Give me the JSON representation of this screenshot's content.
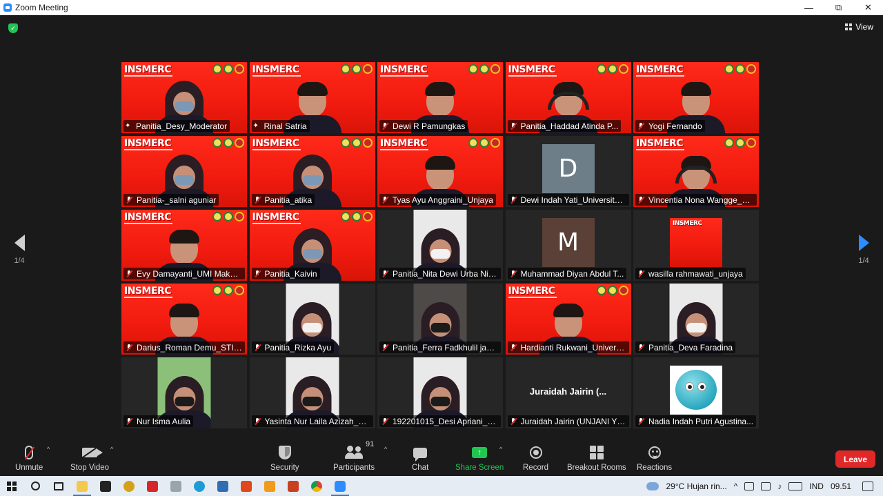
{
  "window": {
    "title": "Zoom Meeting",
    "controls": [
      "minimize",
      "restore",
      "close"
    ]
  },
  "top": {
    "view_label": "View"
  },
  "pager": {
    "left": "1/4",
    "right": "1/4"
  },
  "banner": {
    "text": "INSMERC"
  },
  "participants": [
    {
      "name": "Panitia_Desy_Moderator",
      "style": "banner",
      "active": true,
      "mic": "pinned"
    },
    {
      "name": "Rinal Satria",
      "style": "banner",
      "mic": "pinned"
    },
    {
      "name": "Dewi R Pamungkas",
      "style": "banner",
      "mic": "muted"
    },
    {
      "name": "Panitia_Haddad Atinda P...",
      "style": "banner",
      "mic": "muted"
    },
    {
      "name": "Yogi Fernando",
      "style": "banner",
      "mic": "muted"
    },
    {
      "name": "Panitia-_salni aguniar",
      "style": "banner",
      "mic": "muted"
    },
    {
      "name": "Panitia_atika",
      "style": "banner",
      "mic": "muted"
    },
    {
      "name": "Tyas Ayu Anggraini_Unjaya",
      "style": "banner",
      "mic": "muted"
    },
    {
      "name": "Dewi Indah Yati_Universitas...",
      "style": "avatar",
      "initial": "D",
      "avatar_color": "#6e7e89",
      "mic": "muted"
    },
    {
      "name": "Vincentia Nona Wangge_St...",
      "style": "banner",
      "mic": "muted"
    },
    {
      "name": "Evy Damayanti_UMI Makas...",
      "style": "banner",
      "mic": "muted"
    },
    {
      "name": "Panitia_Kaivin",
      "style": "banner",
      "mic": "muted"
    },
    {
      "name": "Panitia_Nita Dewi Urba Nid...",
      "style": "video",
      "mic": "muted"
    },
    {
      "name": "Muhammad Diyan Abdul T...",
      "style": "avatar",
      "initial": "M",
      "avatar_color": "#5a4037",
      "mic": "muted"
    },
    {
      "name": "wasilla rahmawati_unjaya",
      "style": "banner-small",
      "mic": "muted"
    },
    {
      "name": "Darius_Roman Demu_STIK...",
      "style": "banner",
      "mic": "muted"
    },
    {
      "name": "Panitia_Rizka Ayu",
      "style": "video",
      "mic": "muted"
    },
    {
      "name": "Panitia_Ferra Fadkhulil jann...",
      "style": "video-dark",
      "mic": "muted"
    },
    {
      "name": "Hardianti Rukwani_Universi...",
      "style": "banner",
      "mic": "muted"
    },
    {
      "name": "Panitia_Deva Faradina",
      "style": "video",
      "mic": "muted"
    },
    {
      "name": "Nur Isma Aulia",
      "style": "video-green",
      "mic": "muted"
    },
    {
      "name": "Yasinta Nur Laila Azizah_Un...",
      "style": "video",
      "mic": "muted"
    },
    {
      "name": "192201015_Desi Apriani_U...",
      "style": "video",
      "mic": "muted"
    },
    {
      "name": "Juraidah Jairin (UNJANI YO...",
      "style": "name-only",
      "display": "Juraidah Jairin (...",
      "mic": "muted"
    },
    {
      "name": "Nadia Indah Putri Agustina...",
      "style": "fluff",
      "mic": "muted"
    }
  ],
  "toolbar": {
    "unmute": "Unmute",
    "stop_video": "Stop Video",
    "security": "Security",
    "participants": "Participants",
    "participants_count": "91",
    "chat": "Chat",
    "share_screen": "Share Screen",
    "record": "Record",
    "breakout_rooms": "Breakout Rooms",
    "reactions": "Reactions",
    "leave": "Leave"
  },
  "taskbar": {
    "weather": "29°C  Hujan rin...",
    "language": "IND",
    "time": "09.51"
  },
  "colors": {
    "accent": "#2d8cff",
    "share_green": "#23c552",
    "leave_red": "#e02828",
    "banner_red": "#f01a0e",
    "active_outline": "#e3e334"
  }
}
